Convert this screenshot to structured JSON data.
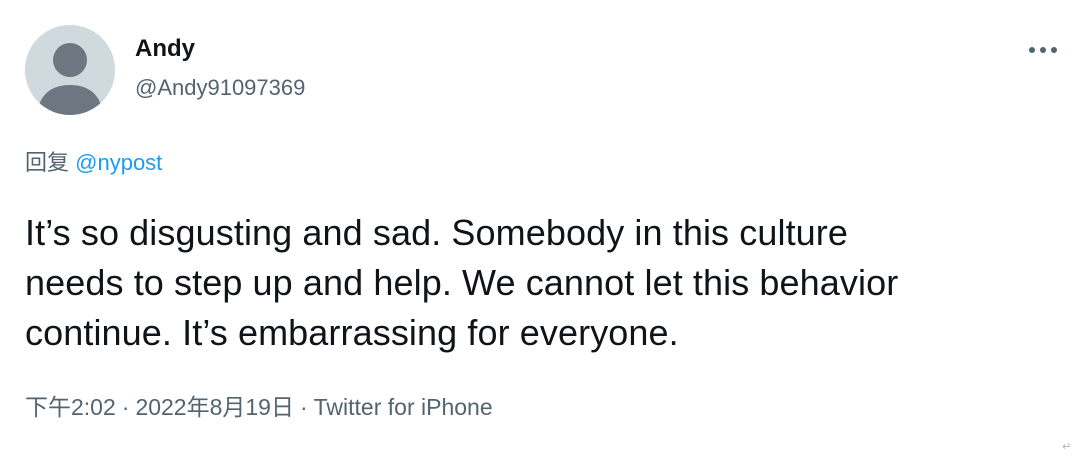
{
  "author": {
    "display_name": "Andy",
    "handle": "@Andy91097369",
    "avatar_icon": "default-profile-icon"
  },
  "menu": {
    "more_icon": "more-options-icon"
  },
  "reply": {
    "prefix": "回复",
    "mention": "@nypost"
  },
  "tweet": {
    "lines": [
      "It’s so disgusting and sad. Somebody in this culture",
      "needs to step up and help. We cannot let this behavior",
      "continue. It’s embarrassing for everyone."
    ]
  },
  "meta": {
    "time": "下午2:02",
    "separator": "·",
    "date": "2022年8月19日",
    "source": "Twitter for iPhone"
  },
  "colors": {
    "text_primary": "#0f1419",
    "text_secondary": "#536471",
    "link": "#1d9bf0",
    "avatar_bg": "#cfd9de",
    "avatar_figure": "#6e7781"
  },
  "corner_mark": "↵"
}
